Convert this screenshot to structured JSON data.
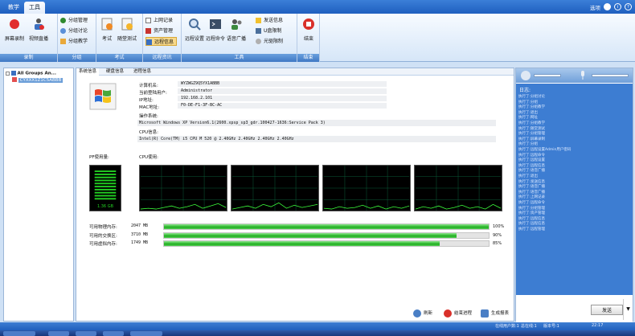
{
  "top_tabs": [
    "教学",
    "工具"
  ],
  "top_right": {
    "options": "选项",
    "help": "?",
    "info": "i"
  },
  "ribbon": {
    "groups": [
      {
        "label": "录制",
        "buttons": [
          "屏幕录制",
          "视频直播"
        ]
      },
      {
        "label": "分组",
        "buttons": [
          "分组管理",
          "分组讨论",
          "分组教学"
        ]
      },
      {
        "label": "考试",
        "buttons": [
          "考试",
          "随堂测试"
        ]
      },
      {
        "label": "远程资讯",
        "buttons": [
          "上网记录",
          "资产管理",
          "远程信息"
        ]
      },
      {
        "label": "工具",
        "buttons": [
          "远程设置",
          "远程命令",
          "语音广播",
          "发送信息",
          "U盘限制",
          "光驱限制"
        ]
      },
      {
        "label": "结束",
        "buttons": [
          "结束"
        ]
      }
    ]
  },
  "tree": {
    "root": "All Groups An...",
    "selected": "CYXXX1Z1C5ABBB"
  },
  "center_tabs": [
    "系统信息",
    "硬盘信息",
    "进程信息"
  ],
  "system_info": {
    "computer_name_label": "计算机名:",
    "computer_name": "WYZWGZ9Q5YX1ABBB",
    "user_label": "当前登陆用户:",
    "user": "Administrator",
    "ip_label": "IP地址:",
    "ip": "192.168.2.101",
    "mac_label": "MAC地址:",
    "mac": "F0-DE-F1-3F-BC-AC",
    "os_label": "操作系统:",
    "os": "Microsoft Windows XP Version6.1(2600.xpsp_sp3_gdr.100427-1636:Service Pack 3)",
    "cpu_label": "CPU信息:",
    "cpu": "Intel(R) Core(TM) i5 CPU       M 520  @ 2.40GHz  2.40GHz  2.40GHz  2.40GHz"
  },
  "usage": {
    "pf_label": "PF使用量:",
    "cpu_label": "CPU使用:",
    "pf_value": "1.36 GB"
  },
  "memory": [
    {
      "label": "可用物理内存:",
      "value": "2047 MB",
      "pct": 100,
      "pct_text": "100%"
    },
    {
      "label": "可用的交换区:",
      "value": "3710 MB",
      "pct": 90,
      "pct_text": "90%"
    },
    {
      "label": "可用虚拟内存:",
      "value": "1749 MB",
      "pct": 85,
      "pct_text": "85%"
    }
  ],
  "center_actions": [
    "刷新",
    "结束进程",
    "生成报表"
  ],
  "log": {
    "title": "日志:",
    "rows": [
      "执行了:分组讨论",
      "执行了:分组",
      "执行了:分组教学",
      "执行了:退出",
      "执行了:网址",
      "执行了:分组教学",
      "执行了:随堂测试",
      "执行了:分组管理",
      "执行了:屏幕录制",
      "执行了:分组",
      "执行了:远程设置Admin用户密码",
      "执行了:远程命令",
      "执行了:远程设置",
      "执行了:远程信息",
      "执行了:语音广播",
      "执行了:退出",
      "执行了:发送信息",
      "执行了:语音广播",
      "执行了:语音广播",
      "执行了:上网记录",
      "执行了:远程命令",
      "执行了:分组管理",
      "执行了:资产管理",
      "执行了:远程信息",
      "执行了:远程信息",
      "执行了:远程管理"
    ]
  },
  "send_label": "发送",
  "status": {
    "online": "在线用户数:1",
    "total": "总在线:1",
    "ver": "版本号:1",
    "time": "22:17"
  }
}
